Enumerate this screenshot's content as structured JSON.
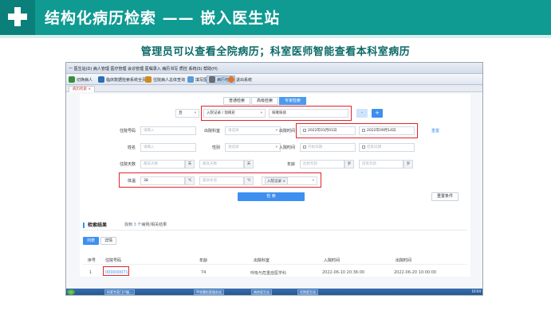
{
  "slide": {
    "title": "结构化病历检索 —— 嵌入医生站",
    "subtitle": "管理员可以查看全院病历；科室医师智能查看本科室病历"
  },
  "app": {
    "menubar_text": "一 医生站(D)  病人管理  医疗管理  会诊管理  医嘱录入  病历书写  质控  系统(S)  帮助(H)",
    "toolbar": [
      {
        "label": "切换病人",
        "icon_color": "#3a8d3a"
      },
      {
        "label": "临床数据检索系统全页",
        "icon_color": "#2b6fb5"
      },
      {
        "label": "住院病人总体查询",
        "icon_color": "#d18a1c"
      },
      {
        "label": "填写医嘱",
        "icon_color": "#5a9ad8"
      },
      {
        "label": "病历检索",
        "icon_color": "#6d6d6d"
      },
      {
        "label": "退出系统",
        "icon_color": "#e0742a"
      }
    ],
    "window_tab": "病历检索 ×",
    "search_modes": [
      "普通检索",
      "高级检索",
      "专家检索"
    ],
    "form": {
      "logic_select": "且",
      "field_select": "入院记录 / 现病史",
      "keyword_value": "咳嗽咳痰",
      "add_minus": "-",
      "add_plus": "+",
      "labels": {
        "inpatient_no": "住院号码",
        "discharge_dept": "出院科室",
        "discharge_time": "出院时间",
        "name": "姓名",
        "gender": "性别",
        "admission_time": "入院时间",
        "days": "住院天数",
        "age": "年龄",
        "temperature": "体温"
      },
      "placeholders": {
        "input": "请输入",
        "select": "请选择",
        "start_date": "开始日期",
        "end_date": "结束日期",
        "min_days": "最低天数",
        "max_days": "最高天数",
        "min_age": "起始年龄",
        "max_age": "结束年龄",
        "max_temp": "最高体温"
      },
      "discharge_start": "2022年01月01日",
      "discharge_end": "2022年09月14日",
      "days_unit": "天",
      "age_unit": "岁",
      "temp_min": "38",
      "temp_unit": "℃",
      "temp_source_tag": "入院记录 ×",
      "reset_link": "重置",
      "search_button": "检 索",
      "save_condition_button": "重置条件"
    },
    "results": {
      "heading": "检索结果",
      "count_prefix": "找到",
      "count_value": "3",
      "count_suffix": "个病例/相关结果",
      "view_tabs": [
        "列表",
        "详情"
      ],
      "columns": [
        "序号",
        "住院号码",
        "年龄",
        "出院科室",
        "入院时间",
        "出院时间"
      ],
      "rows": [
        [
          "1",
          "000000071",
          "74",
          "呼吸与危重症医学科",
          "2022-06-10 20:36:00",
          "2022-06-20 10:00:00"
        ]
      ]
    },
    "taskbar": {
      "tasks": [
        "检索专家门户服...",
        "甲状腺检索服务站",
        "病房医生站",
        "住院医生站"
      ],
      "clock": "10:04"
    }
  }
}
